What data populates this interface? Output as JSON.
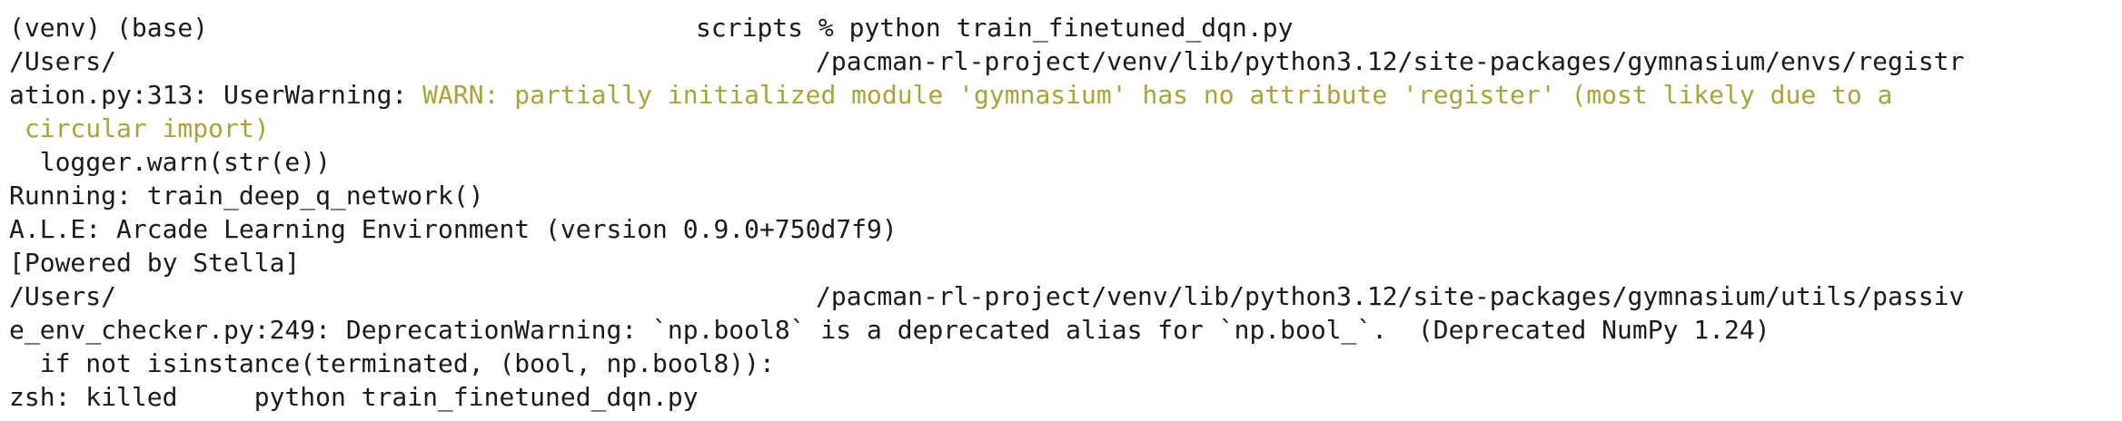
{
  "terminal": {
    "colors": {
      "background": "#ffffff",
      "text": "#1a1a1a",
      "warning_text": "#a8a33c"
    },
    "lines": [
      {
        "prefix": "(venv) (base) ",
        "suffix": "scripts % python train_finetuned_dqn.py"
      },
      {
        "prefix": "/Users/",
        "suffix": "/pacman-rl-project/venv/lib/python3.12/site-packages/gymnasium/envs/registr"
      },
      {
        "prefix": "ation.py:313: UserWarning: ",
        "warning": "WARN: partially initialized module 'gymnasium' has no attribute 'register' (most likely due to a"
      },
      {
        "warning": " circular import)"
      },
      {
        "text": "  logger.warn(str(e))"
      },
      {
        "text": "Running: train_deep_q_network()"
      },
      {
        "text": "A.L.E: Arcade Learning Environment (version 0.9.0+750d7f9)"
      },
      {
        "text": "[Powered by Stella]"
      },
      {
        "prefix": "/Users/",
        "suffix": "/pacman-rl-project/venv/lib/python3.12/site-packages/gymnasium/utils/passiv"
      },
      {
        "text": "e_env_checker.py:249: DeprecationWarning: `np.bool8` is a deprecated alias for `np.bool_`.  (Deprecated NumPy 1.24)"
      },
      {
        "text": "  if not isinstance(terminated, (bool, np.bool8)):"
      },
      {
        "text": "zsh: killed     python train_finetuned_dqn.py"
      }
    ]
  }
}
